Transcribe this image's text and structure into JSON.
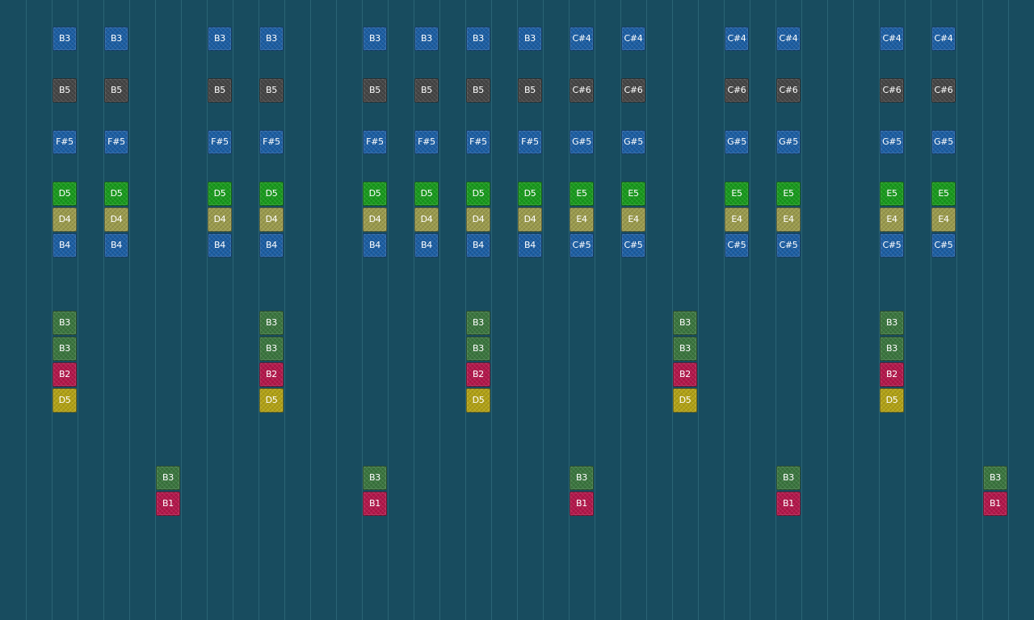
{
  "colors": {
    "background": "#184c5f",
    "grid_line": "#2b6475",
    "blue": "#1c5ea3",
    "dark": "#454545",
    "green": "#199a1d",
    "olive": "#9b9b4d",
    "forest": "#3b763f",
    "crimson": "#b3174b",
    "yellow": "#b2a216"
  },
  "notes": [
    {
      "col": 2,
      "row": 1,
      "label": "B3",
      "color": "blue"
    },
    {
      "col": 2,
      "row": 3,
      "label": "B5",
      "color": "dark"
    },
    {
      "col": 2,
      "row": 5,
      "label": "F#5",
      "color": "blue"
    },
    {
      "col": 2,
      "row": 7,
      "label": "D5",
      "color": "green"
    },
    {
      "col": 2,
      "row": 8,
      "label": "D4",
      "color": "olive"
    },
    {
      "col": 2,
      "row": 9,
      "label": "B4",
      "color": "blue"
    },
    {
      "col": 2,
      "row": 12,
      "label": "B3",
      "color": "forest"
    },
    {
      "col": 2,
      "row": 13,
      "label": "B3",
      "color": "forest"
    },
    {
      "col": 2,
      "row": 14,
      "label": "B2",
      "color": "crimson"
    },
    {
      "col": 2,
      "row": 15,
      "label": "D5",
      "color": "yellow"
    },
    {
      "col": 4,
      "row": 1,
      "label": "B3",
      "color": "blue"
    },
    {
      "col": 4,
      "row": 3,
      "label": "B5",
      "color": "dark"
    },
    {
      "col": 4,
      "row": 5,
      "label": "F#5",
      "color": "blue"
    },
    {
      "col": 4,
      "row": 7,
      "label": "D5",
      "color": "green"
    },
    {
      "col": 4,
      "row": 8,
      "label": "D4",
      "color": "olive"
    },
    {
      "col": 4,
      "row": 9,
      "label": "B4",
      "color": "blue"
    },
    {
      "col": 6,
      "row": 18,
      "label": "B3",
      "color": "forest"
    },
    {
      "col": 6,
      "row": 19,
      "label": "B1",
      "color": "crimson"
    },
    {
      "col": 8,
      "row": 1,
      "label": "B3",
      "color": "blue"
    },
    {
      "col": 8,
      "row": 3,
      "label": "B5",
      "color": "dark"
    },
    {
      "col": 8,
      "row": 5,
      "label": "F#5",
      "color": "blue"
    },
    {
      "col": 8,
      "row": 7,
      "label": "D5",
      "color": "green"
    },
    {
      "col": 8,
      "row": 8,
      "label": "D4",
      "color": "olive"
    },
    {
      "col": 8,
      "row": 9,
      "label": "B4",
      "color": "blue"
    },
    {
      "col": 10,
      "row": 1,
      "label": "B3",
      "color": "blue"
    },
    {
      "col": 10,
      "row": 3,
      "label": "B5",
      "color": "dark"
    },
    {
      "col": 10,
      "row": 5,
      "label": "F#5",
      "color": "blue"
    },
    {
      "col": 10,
      "row": 7,
      "label": "D5",
      "color": "green"
    },
    {
      "col": 10,
      "row": 8,
      "label": "D4",
      "color": "olive"
    },
    {
      "col": 10,
      "row": 9,
      "label": "B4",
      "color": "blue"
    },
    {
      "col": 10,
      "row": 12,
      "label": "B3",
      "color": "forest"
    },
    {
      "col": 10,
      "row": 13,
      "label": "B3",
      "color": "forest"
    },
    {
      "col": 10,
      "row": 14,
      "label": "B2",
      "color": "crimson"
    },
    {
      "col": 10,
      "row": 15,
      "label": "D5",
      "color": "yellow"
    },
    {
      "col": 14,
      "row": 1,
      "label": "B3",
      "color": "blue"
    },
    {
      "col": 14,
      "row": 3,
      "label": "B5",
      "color": "dark"
    },
    {
      "col": 14,
      "row": 5,
      "label": "F#5",
      "color": "blue"
    },
    {
      "col": 14,
      "row": 7,
      "label": "D5",
      "color": "green"
    },
    {
      "col": 14,
      "row": 8,
      "label": "D4",
      "color": "olive"
    },
    {
      "col": 14,
      "row": 9,
      "label": "B4",
      "color": "blue"
    },
    {
      "col": 14,
      "row": 18,
      "label": "B3",
      "color": "forest"
    },
    {
      "col": 14,
      "row": 19,
      "label": "B1",
      "color": "crimson"
    },
    {
      "col": 16,
      "row": 1,
      "label": "B3",
      "color": "blue"
    },
    {
      "col": 16,
      "row": 3,
      "label": "B5",
      "color": "dark"
    },
    {
      "col": 16,
      "row": 5,
      "label": "F#5",
      "color": "blue"
    },
    {
      "col": 16,
      "row": 7,
      "label": "D5",
      "color": "green"
    },
    {
      "col": 16,
      "row": 8,
      "label": "D4",
      "color": "olive"
    },
    {
      "col": 16,
      "row": 9,
      "label": "B4",
      "color": "blue"
    },
    {
      "col": 18,
      "row": 1,
      "label": "B3",
      "color": "blue"
    },
    {
      "col": 18,
      "row": 3,
      "label": "B5",
      "color": "dark"
    },
    {
      "col": 18,
      "row": 5,
      "label": "F#5",
      "color": "blue"
    },
    {
      "col": 18,
      "row": 7,
      "label": "D5",
      "color": "green"
    },
    {
      "col": 18,
      "row": 8,
      "label": "D4",
      "color": "olive"
    },
    {
      "col": 18,
      "row": 9,
      "label": "B4",
      "color": "blue"
    },
    {
      "col": 18,
      "row": 12,
      "label": "B3",
      "color": "forest"
    },
    {
      "col": 18,
      "row": 13,
      "label": "B3",
      "color": "forest"
    },
    {
      "col": 18,
      "row": 14,
      "label": "B2",
      "color": "crimson"
    },
    {
      "col": 18,
      "row": 15,
      "label": "D5",
      "color": "yellow"
    },
    {
      "col": 20,
      "row": 1,
      "label": "B3",
      "color": "blue"
    },
    {
      "col": 20,
      "row": 3,
      "label": "B5",
      "color": "dark"
    },
    {
      "col": 20,
      "row": 5,
      "label": "F#5",
      "color": "blue"
    },
    {
      "col": 20,
      "row": 7,
      "label": "D5",
      "color": "green"
    },
    {
      "col": 20,
      "row": 8,
      "label": "D4",
      "color": "olive"
    },
    {
      "col": 20,
      "row": 9,
      "label": "B4",
      "color": "blue"
    },
    {
      "col": 22,
      "row": 1,
      "label": "C#4",
      "color": "blue"
    },
    {
      "col": 22,
      "row": 3,
      "label": "C#6",
      "color": "dark"
    },
    {
      "col": 22,
      "row": 5,
      "label": "G#5",
      "color": "blue"
    },
    {
      "col": 22,
      "row": 7,
      "label": "E5",
      "color": "green"
    },
    {
      "col": 22,
      "row": 8,
      "label": "E4",
      "color": "olive"
    },
    {
      "col": 22,
      "row": 9,
      "label": "C#5",
      "color": "blue"
    },
    {
      "col": 22,
      "row": 18,
      "label": "B3",
      "color": "forest"
    },
    {
      "col": 22,
      "row": 19,
      "label": "B1",
      "color": "crimson"
    },
    {
      "col": 24,
      "row": 1,
      "label": "C#4",
      "color": "blue"
    },
    {
      "col": 24,
      "row": 3,
      "label": "C#6",
      "color": "dark"
    },
    {
      "col": 24,
      "row": 5,
      "label": "G#5",
      "color": "blue"
    },
    {
      "col": 24,
      "row": 7,
      "label": "E5",
      "color": "green"
    },
    {
      "col": 24,
      "row": 8,
      "label": "E4",
      "color": "olive"
    },
    {
      "col": 24,
      "row": 9,
      "label": "C#5",
      "color": "blue"
    },
    {
      "col": 26,
      "row": 12,
      "label": "B3",
      "color": "forest"
    },
    {
      "col": 26,
      "row": 13,
      "label": "B3",
      "color": "forest"
    },
    {
      "col": 26,
      "row": 14,
      "label": "B2",
      "color": "crimson"
    },
    {
      "col": 26,
      "row": 15,
      "label": "D5",
      "color": "yellow"
    },
    {
      "col": 28,
      "row": 1,
      "label": "C#4",
      "color": "blue"
    },
    {
      "col": 28,
      "row": 3,
      "label": "C#6",
      "color": "dark"
    },
    {
      "col": 28,
      "row": 5,
      "label": "G#5",
      "color": "blue"
    },
    {
      "col": 28,
      "row": 7,
      "label": "E5",
      "color": "green"
    },
    {
      "col": 28,
      "row": 8,
      "label": "E4",
      "color": "olive"
    },
    {
      "col": 28,
      "row": 9,
      "label": "C#5",
      "color": "blue"
    },
    {
      "col": 30,
      "row": 1,
      "label": "C#4",
      "color": "blue"
    },
    {
      "col": 30,
      "row": 3,
      "label": "C#6",
      "color": "dark"
    },
    {
      "col": 30,
      "row": 5,
      "label": "G#5",
      "color": "blue"
    },
    {
      "col": 30,
      "row": 7,
      "label": "E5",
      "color": "green"
    },
    {
      "col": 30,
      "row": 8,
      "label": "E4",
      "color": "olive"
    },
    {
      "col": 30,
      "row": 9,
      "label": "C#5",
      "color": "blue"
    },
    {
      "col": 30,
      "row": 18,
      "label": "B3",
      "color": "forest"
    },
    {
      "col": 30,
      "row": 19,
      "label": "B1",
      "color": "crimson"
    },
    {
      "col": 34,
      "row": 1,
      "label": "C#4",
      "color": "blue"
    },
    {
      "col": 34,
      "row": 3,
      "label": "C#6",
      "color": "dark"
    },
    {
      "col": 34,
      "row": 5,
      "label": "G#5",
      "color": "blue"
    },
    {
      "col": 34,
      "row": 7,
      "label": "E5",
      "color": "green"
    },
    {
      "col": 34,
      "row": 8,
      "label": "E4",
      "color": "olive"
    },
    {
      "col": 34,
      "row": 9,
      "label": "C#5",
      "color": "blue"
    },
    {
      "col": 34,
      "row": 12,
      "label": "B3",
      "color": "forest"
    },
    {
      "col": 34,
      "row": 13,
      "label": "B3",
      "color": "forest"
    },
    {
      "col": 34,
      "row": 14,
      "label": "B2",
      "color": "crimson"
    },
    {
      "col": 34,
      "row": 15,
      "label": "D5",
      "color": "yellow"
    },
    {
      "col": 36,
      "row": 1,
      "label": "C#4",
      "color": "blue"
    },
    {
      "col": 36,
      "row": 3,
      "label": "C#6",
      "color": "dark"
    },
    {
      "col": 36,
      "row": 5,
      "label": "G#5",
      "color": "blue"
    },
    {
      "col": 36,
      "row": 7,
      "label": "E5",
      "color": "green"
    },
    {
      "col": 36,
      "row": 8,
      "label": "E4",
      "color": "olive"
    },
    {
      "col": 36,
      "row": 9,
      "label": "C#5",
      "color": "blue"
    },
    {
      "col": 38,
      "row": 18,
      "label": "B3",
      "color": "forest"
    },
    {
      "col": 38,
      "row": 19,
      "label": "B1",
      "color": "crimson"
    }
  ]
}
